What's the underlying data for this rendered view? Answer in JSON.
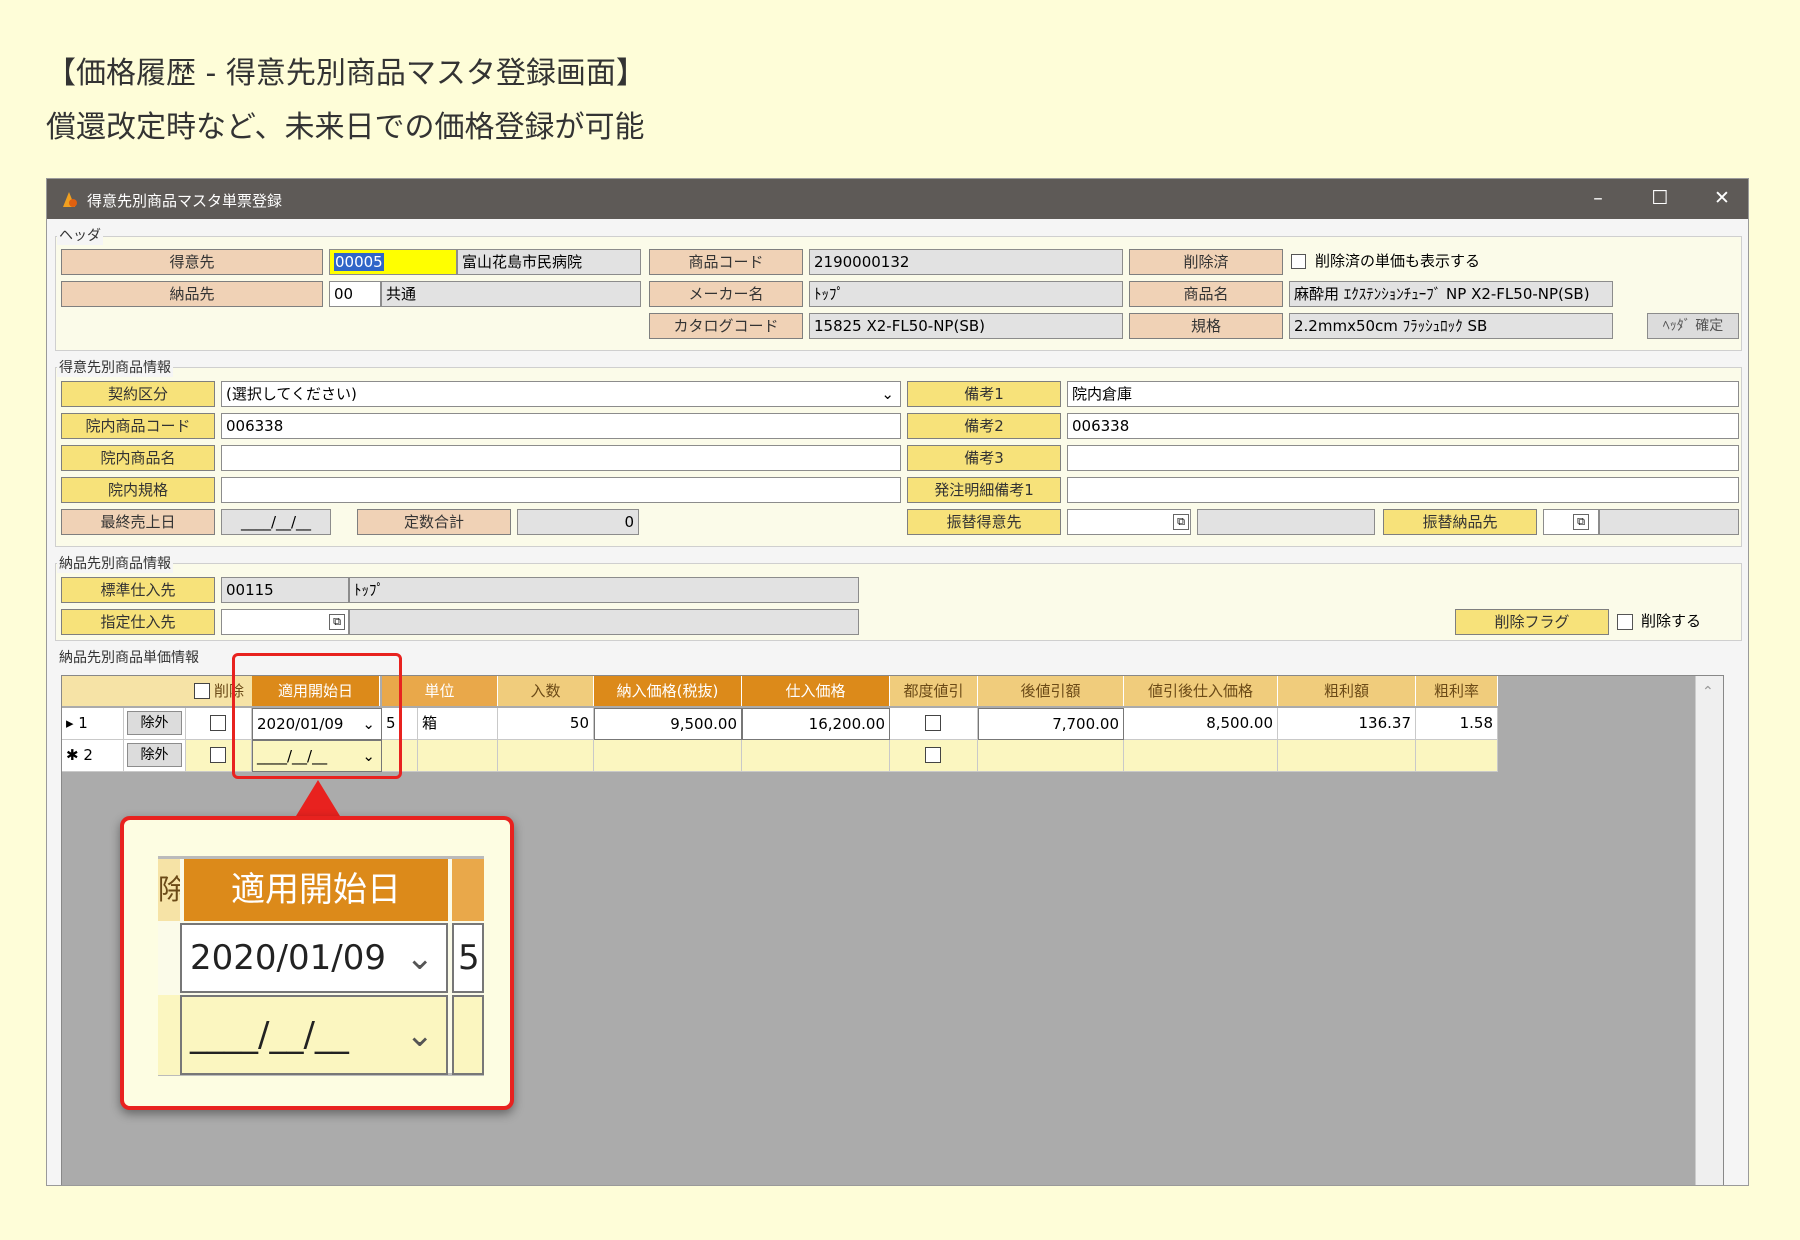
{
  "caption": {
    "title": "【価格履歴 - 得意先別商品マスタ登録画面】",
    "subtitle": "償還改定時など、未来日での価格登録が可能"
  },
  "window": {
    "title": "得意先別商品マスタ単票登録",
    "min": "–",
    "max": "☐",
    "close": "✕"
  },
  "header": {
    "legend": "ヘッダ",
    "customer_label": "得意先",
    "customer_code": "00005",
    "customer_name": "富山花島市民病院",
    "delivery_label": "納品先",
    "delivery_code": "00",
    "delivery_name": "共通",
    "product_code_label": "商品コード",
    "product_code": "2190000132",
    "maker_label": "メーカー名",
    "maker": "ﾄｯﾌﾟ",
    "catalog_label": "カタログコード",
    "catalog": "15825 X2-FL50-NP(SB)",
    "deleted_label": "削除済",
    "show_deleted": "削除済の単価も表示する",
    "product_name_label": "商品名",
    "product_name": "麻酔用 ｴｸｽﾃﾝｼｮﾝﾁｭｰﾌﾞ NP X2-FL50-NP(SB)",
    "spec_label": "規格",
    "spec": "2.2mmx50cm ﾌﾗｯｼｭﾛｯｸ SB",
    "confirm_button": "ﾍｯﾀﾞ 確定"
  },
  "customer_info": {
    "legend": "得意先別商品情報",
    "contract_label": "契約区分",
    "contract_value": "(選択してください)",
    "hosp_code_label": "院内商品コード",
    "hosp_code": "006338",
    "hosp_name_label": "院内商品名",
    "hosp_name": "",
    "hosp_spec_label": "院内規格",
    "hosp_spec": "",
    "last_sale_label": "最終売上日",
    "last_sale": "____/__/__",
    "qty_total_label": "定数合計",
    "qty_total": "0",
    "note1_label": "備考1",
    "note1": "院内倉庫",
    "note2_label": "備考2",
    "note2": "006338",
    "note3_label": "備考3",
    "note3": "",
    "order_note_label": "発注明細備考1",
    "order_note": "",
    "transfer_customer_label": "振替得意先",
    "transfer_delivery_label": "振替納品先"
  },
  "delivery_info": {
    "legend": "納品先別商品情報",
    "std_supplier_label": "標準仕入先",
    "std_supplier_code": "00115",
    "std_supplier_name": "ﾄｯﾌﾟ",
    "designated_supplier_label": "指定仕入先",
    "delete_flag_label": "削除フラグ",
    "delete_check": "削除する"
  },
  "price_info": {
    "legend": "納品先別商品単価情報",
    "headers": {
      "delete": "削除",
      "start_date": "適用開始日",
      "unit": "単位",
      "quantity": "入数",
      "delivery_price": "納入価格(税抜)",
      "purchase_price": "仕入価格",
      "each_discount": "都度値引",
      "post_discount": "後値引額",
      "net_purchase": "値引後仕入価格",
      "gross_profit": "粗利額",
      "gross_rate": "粗利率"
    },
    "rows": [
      {
        "marker": "▸ 1",
        "exclude": "除外",
        "start_date": "2020/01/09",
        "unit_code": "5",
        "unit": "箱",
        "quantity": "50",
        "delivery_price": "9,500.00",
        "purchase_price": "16,200.00",
        "post_discount": "7,700.00",
        "net_purchase": "8,500.00",
        "gross_profit": "136.37",
        "gross_rate": "1.58"
      },
      {
        "marker": "✱ 2",
        "exclude": "除外",
        "start_date": "____/__/__"
      }
    ]
  },
  "zoom": {
    "header": "適用開始日",
    "date1": "2020/01/09",
    "unit_code": "5",
    "date2": "____/__/__",
    "edge_char": "除"
  },
  "colors": {
    "highlight": "#e8221f",
    "header_orange": "#dc8a1a",
    "label_peach": "#f0d2b6",
    "label_yellow": "#f7e27a"
  }
}
